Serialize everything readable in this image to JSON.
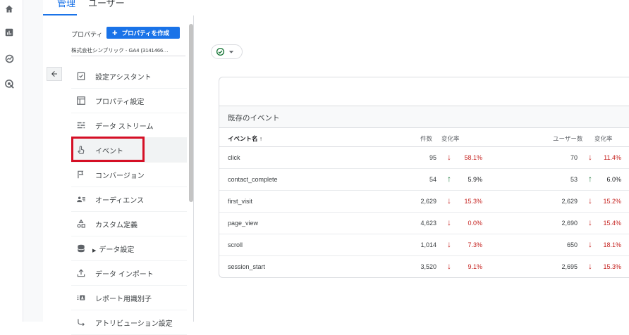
{
  "tabs": [
    {
      "label": "管理"
    },
    {
      "label": "ユーザー"
    }
  ],
  "admin": {
    "property_label": "プロパティ",
    "create_button": "プロパティを作成",
    "account_name": "株式会社シンプリック - GA4 (3141466…",
    "nav_items": [
      {
        "label": "設定アシスタント",
        "icon": "checklist-icon"
      },
      {
        "label": "プロパティ設定",
        "icon": "layout-icon"
      },
      {
        "label": "データ ストリーム",
        "icon": "stream-icon"
      },
      {
        "label": "イベント",
        "icon": "touch-icon"
      },
      {
        "label": "コンバージョン",
        "icon": "flag-icon"
      },
      {
        "label": "オーディエンス",
        "icon": "audience-icon"
      },
      {
        "label": "カスタム定義",
        "icon": "shapes-icon"
      },
      {
        "label": "データ設定",
        "icon": "database-icon"
      },
      {
        "label": "データ インポート",
        "icon": "upload-icon"
      },
      {
        "label": "レポート用識別子",
        "icon": "id-icon"
      },
      {
        "label": "アトリビューション設定",
        "icon": "attribution-icon"
      }
    ]
  },
  "events_table": {
    "title": "既存のイベント",
    "columns": {
      "name": "イベント名 ↑",
      "count": "件数",
      "count_change": "変化率",
      "users": "ユーザー数",
      "users_change": "変化率"
    },
    "rows": [
      {
        "name": "click",
        "count": "95",
        "count_dir": "down",
        "count_change": "58.1%",
        "users": "70",
        "users_dir": "down",
        "users_change": "11.4%"
      },
      {
        "name": "contact_complete",
        "count": "54",
        "count_dir": "up",
        "count_change": "5.9%",
        "users": "53",
        "users_dir": "up",
        "users_change": "6.0%"
      },
      {
        "name": "first_visit",
        "count": "2,629",
        "count_dir": "down",
        "count_change": "15.3%",
        "users": "2,629",
        "users_dir": "down",
        "users_change": "15.2%"
      },
      {
        "name": "page_view",
        "count": "4,623",
        "count_dir": "down",
        "count_change": "0.0%",
        "users": "2,690",
        "users_dir": "down",
        "users_change": "15.4%"
      },
      {
        "name": "scroll",
        "count": "1,014",
        "count_dir": "down",
        "count_change": "7.3%",
        "users": "650",
        "users_dir": "down",
        "users_change": "18.1%"
      },
      {
        "name": "session_start",
        "count": "3,520",
        "count_dir": "down",
        "count_change": "9.1%",
        "users": "2,695",
        "users_dir": "down",
        "users_change": "15.3%"
      }
    ]
  },
  "colors": {
    "accent": "#1a73e8",
    "down": "#c5221f",
    "up": "#137333",
    "highlight": "#d50f25"
  }
}
